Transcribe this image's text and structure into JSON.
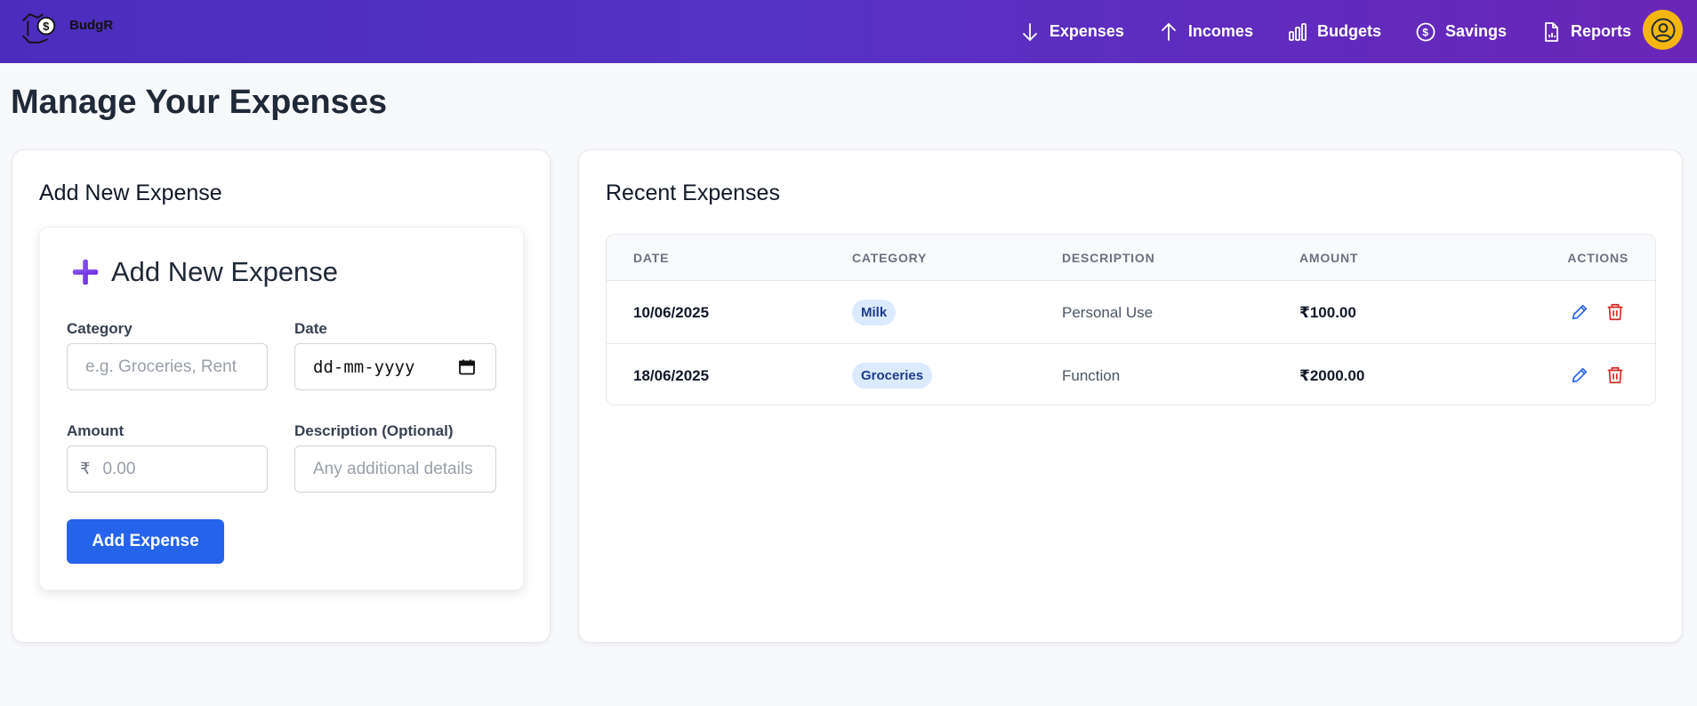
{
  "brand": {
    "name": "BudgR",
    "logo_icon": "money-hands-logo"
  },
  "nav": {
    "items": [
      {
        "label": "Expenses",
        "icon": "arrow-down-icon"
      },
      {
        "label": "Incomes",
        "icon": "arrow-up-icon"
      },
      {
        "label": "Budgets",
        "icon": "bar-chart-icon"
      },
      {
        "label": "Savings",
        "icon": "dollar-circle-icon"
      },
      {
        "label": "Reports",
        "icon": "report-file-icon"
      }
    ],
    "avatar_icon": "user-circle-icon",
    "avatar_color": "#f5b70f"
  },
  "page": {
    "title": "Manage Your Expenses"
  },
  "add_card": {
    "heading": "Add New Expense",
    "form": {
      "title": "Add New Expense",
      "title_icon": "plus-icon",
      "category_label": "Category",
      "category_placeholder": "e.g. Groceries, Rent",
      "date_label": "Date",
      "date_placeholder": "dd-mm-yyyy",
      "amount_label": "Amount",
      "amount_prefix": "₹",
      "amount_placeholder": "0.00",
      "description_label": "Description (Optional)",
      "description_placeholder": "Any additional details",
      "submit_label": "Add Expense"
    }
  },
  "recent_card": {
    "heading": "Recent Expenses",
    "columns": [
      "DATE",
      "CATEGORY",
      "DESCRIPTION",
      "AMOUNT",
      "ACTIONS"
    ],
    "rows": [
      {
        "date": "10/06/2025",
        "category": "Milk",
        "description": "Personal Use",
        "amount": "₹100.00"
      },
      {
        "date": "18/06/2025",
        "category": "Groceries",
        "description": "Function",
        "amount": "₹2000.00"
      }
    ]
  },
  "colors": {
    "nav_gradient_start": "#4b2dbd",
    "nav_gradient_end": "#6a26b8",
    "primary_button": "#2563eb",
    "edit_icon": "#2563eb",
    "delete_icon": "#dc2626",
    "badge_bg": "#dbeafe"
  }
}
